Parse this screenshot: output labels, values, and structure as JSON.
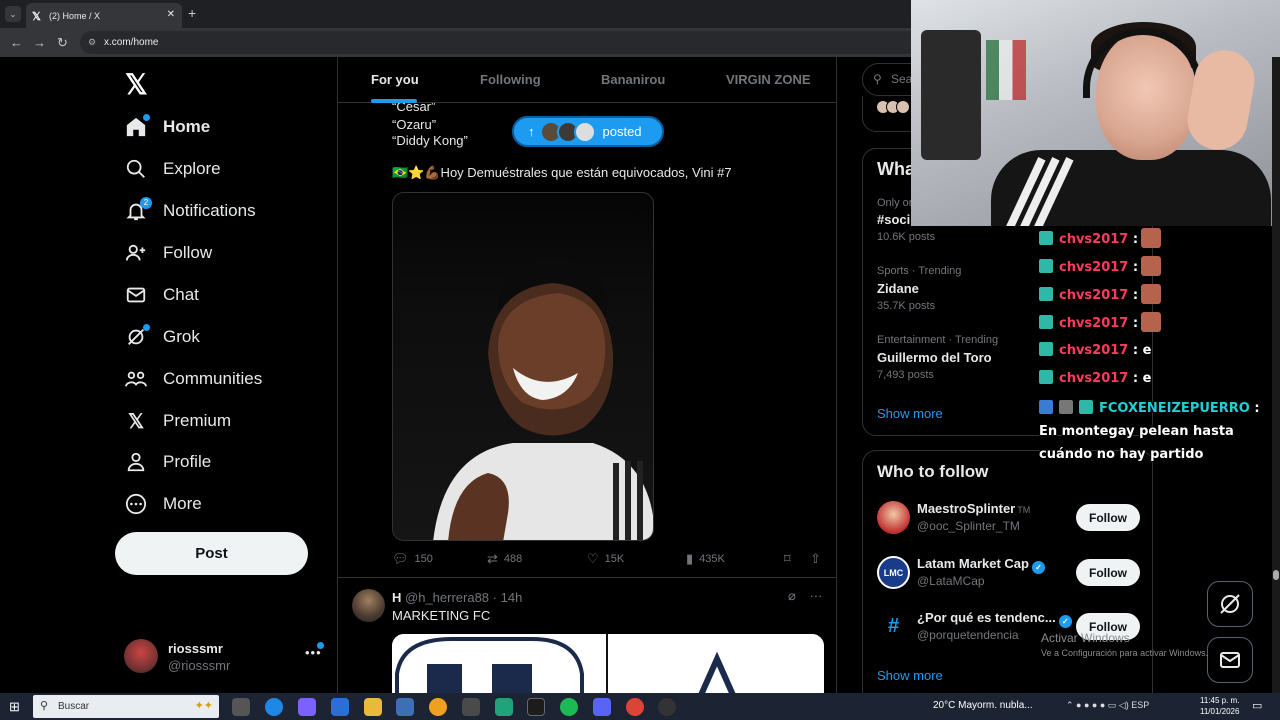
{
  "browser": {
    "tab_title": "(2) Home / X",
    "url": "x.com/home"
  },
  "nav": {
    "items": [
      {
        "label": "Home",
        "icon": "home-icon"
      },
      {
        "label": "Explore",
        "icon": "search-icon"
      },
      {
        "label": "Notifications",
        "icon": "bell-icon",
        "badge": "2"
      },
      {
        "label": "Follow",
        "icon": "add-person-icon"
      },
      {
        "label": "Chat",
        "icon": "mail-icon"
      },
      {
        "label": "Grok",
        "icon": "grok-icon"
      },
      {
        "label": "Communities",
        "icon": "people-icon"
      },
      {
        "label": "Premium",
        "icon": "x-logo-icon"
      },
      {
        "label": "Profile",
        "icon": "person-icon"
      },
      {
        "label": "More",
        "icon": "more-circle-icon"
      }
    ],
    "post_label": "Post",
    "account": {
      "name": "riosssmr",
      "handle": "@riosssmr"
    }
  },
  "timeline": {
    "tabs": [
      "For you",
      "Following",
      "Bananirou",
      "VIRGIN ZONE"
    ],
    "quote_lines": [
      "“César”",
      "“Ozaru”",
      "“Diddy Kong”"
    ],
    "new_posts_label": "posted",
    "tweet1": {
      "text": "🇧🇷⭐💪🏾Hoy Demuéstrales que están equivocados, Vini #7",
      "replies": "150",
      "reposts": "488",
      "likes": "15K",
      "views": "435K"
    },
    "tweet2": {
      "name": "H",
      "handle": "@h_herrera88",
      "time": "· 14h",
      "text": "MARKETING FC"
    }
  },
  "sidebar": {
    "search_placeholder": "Sea",
    "trends_heading": "Wha",
    "trends": [
      {
        "meta": "Only or",
        "name": "#soci",
        "count": "10.6K posts"
      },
      {
        "meta": "Sports · Trending",
        "name": "Zidane",
        "count": "35.7K posts"
      },
      {
        "meta": "Entertainment · Trending",
        "name": "Guillermo del Toro",
        "count": "7,493 posts"
      }
    ],
    "show_more": "Show more",
    "who_heading": "Who to follow",
    "who": [
      {
        "name": "MaestroSplinter",
        "suffix": "TM",
        "handle": "@ooc_Splinter_TM",
        "verified": false
      },
      {
        "name": "Latam Market Cap",
        "suffix": "",
        "handle": "@LataMCap",
        "verified": true
      },
      {
        "name": "¿Por qué es tendenc...",
        "suffix": "",
        "handle": "@porquetendencia",
        "verified": true
      }
    ],
    "follow_label": "Follow"
  },
  "chat": {
    "lines": [
      {
        "user": "chvs2017",
        "msg": ":",
        "emote": true
      },
      {
        "user": "chvs2017",
        "msg": ":",
        "emote": true
      },
      {
        "user": "chvs2017",
        "msg": ":",
        "emote": true
      },
      {
        "user": "chvs2017",
        "msg": ":",
        "emote": true
      },
      {
        "user": "chvs2017",
        "msg": ": e",
        "emote": false
      },
      {
        "user": "chvs2017",
        "msg": ": e",
        "emote": false
      }
    ],
    "long_line": {
      "user": "FCOXENEIZEPUERRO",
      "msg": ": En montegay pelean hasta cuándo no hay partido"
    }
  },
  "windows": {
    "activate_title": "Activar Windows",
    "activate_sub": "Ve a Configuración para activar Windows.",
    "search_placeholder": "Buscar",
    "weather": "20°C  Mayorm. nubla...",
    "lang": "ESP",
    "time": "11:45 p. m.",
    "date": "11/01/2026"
  },
  "colors": {
    "accent": "#1d9bf0",
    "chat_user": "#ff3b5c",
    "chat_user2": "#21d0d6"
  }
}
